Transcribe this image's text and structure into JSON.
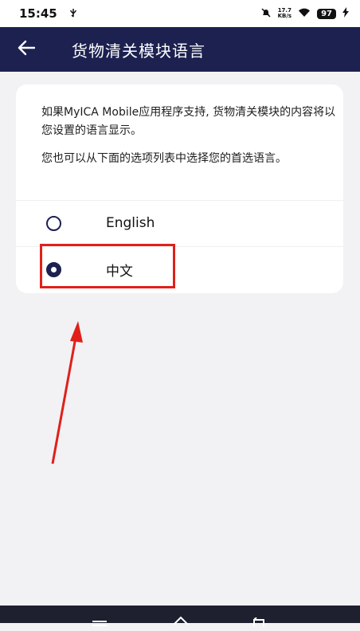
{
  "status_bar": {
    "time": "15:45",
    "net_speed_value": "17.7",
    "net_speed_unit": "KB/s",
    "battery": "97"
  },
  "app_bar": {
    "title": "货物清关模块语言"
  },
  "card": {
    "description_1": "如果MyICA Mobile应用程序支持, 货物清关模块的内容将以您设置的语言显示。",
    "description_2": "您也可以从下面的选项列表中选择您的首选语言。"
  },
  "options": [
    {
      "label": "English",
      "selected": false
    },
    {
      "label": "中文",
      "selected": true
    }
  ],
  "colors": {
    "primary": "#1c2150",
    "annotation": "#e0201a"
  }
}
